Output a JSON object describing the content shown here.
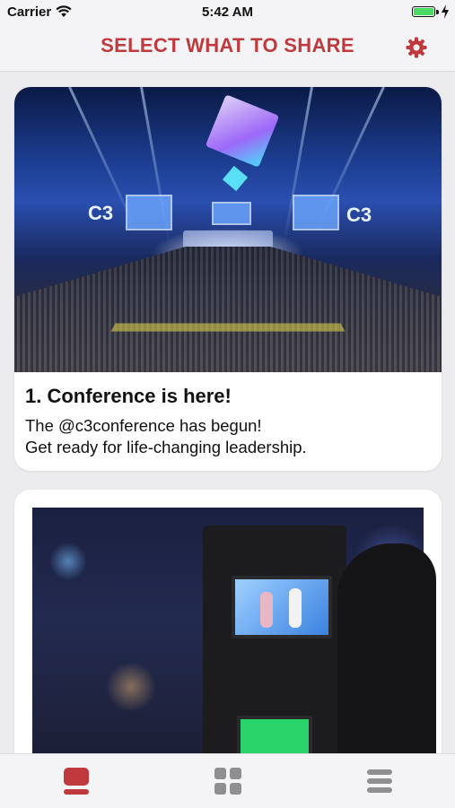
{
  "status_bar": {
    "carrier": "Carrier",
    "time": "5:42 AM"
  },
  "header": {
    "title": "SELECT WHAT TO SHARE",
    "settings_icon": "gear-icon"
  },
  "colors": {
    "accent": "#c0393d",
    "inactive_icon": "#8e8e93",
    "battery": "#4cd964"
  },
  "posts": [
    {
      "title": "1. Conference is here!",
      "body": "The @c3conference has begun!\nGet ready for life-changing leadership."
    }
  ],
  "tab_bar": {
    "tabs": [
      {
        "icon": "single-card-icon",
        "active": true
      },
      {
        "icon": "grid-icon",
        "active": false
      },
      {
        "icon": "list-icon",
        "active": false
      }
    ]
  }
}
